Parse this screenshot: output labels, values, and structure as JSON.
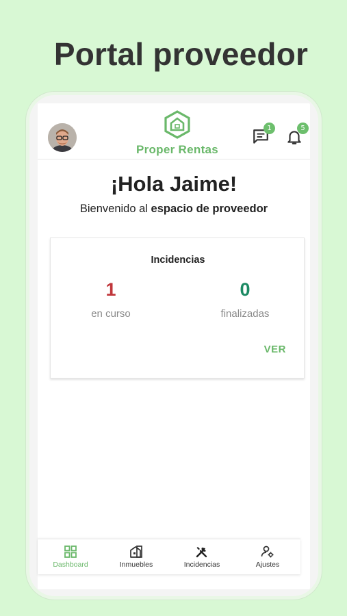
{
  "promo": {
    "title": "Portal proveedor"
  },
  "header": {
    "logo_text": "Proper Rentas",
    "messages_badge": "1",
    "notifications_badge": "5"
  },
  "greeting": {
    "title": "¡Hola Jaime!",
    "subtitle_prefix": "Bienvenido al ",
    "subtitle_bold": "espacio de proveedor"
  },
  "incidents_card": {
    "title": "Incidencias",
    "in_progress_value": "1",
    "in_progress_label": "en curso",
    "finished_value": "0",
    "finished_label": "finalizadas",
    "view_button": "VER"
  },
  "bottom_nav": {
    "items": [
      {
        "label": "Dashboard",
        "icon": "dashboard-icon",
        "active": true
      },
      {
        "label": "Inmuebles",
        "icon": "building-icon",
        "active": false
      },
      {
        "label": "Incidencias",
        "icon": "tools-icon",
        "active": false
      },
      {
        "label": "Ajustes",
        "icon": "user-settings-icon",
        "active": false
      }
    ]
  },
  "colors": {
    "background": "#d8f8d4",
    "accent": "#6ab86a",
    "in_progress": "#c0373b",
    "finished": "#1c8a63"
  }
}
